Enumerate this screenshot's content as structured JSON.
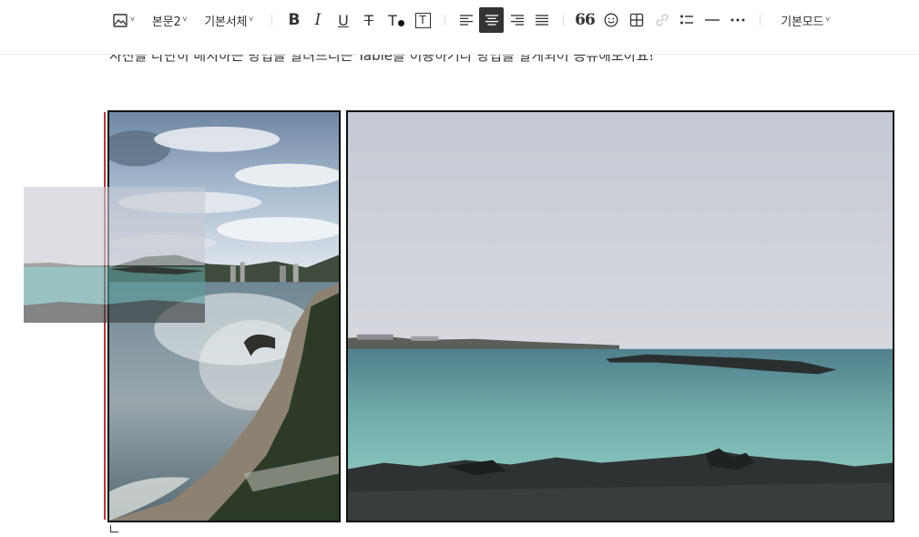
{
  "toolbar": {
    "items": [
      {
        "name": "image-insert",
        "icon": "image-icon",
        "has_caret": true
      },
      {
        "name": "paragraph-style",
        "label": "본문2",
        "has_caret": true
      },
      {
        "name": "font-family",
        "label": "기본서체",
        "has_caret": true
      },
      {
        "name": "bold",
        "label": "B"
      },
      {
        "name": "italic",
        "label": "I"
      },
      {
        "name": "underline",
        "label": "U"
      },
      {
        "name": "strikethrough",
        "label": "T"
      },
      {
        "name": "text-color",
        "label": "T"
      },
      {
        "name": "text-background",
        "label": "T"
      },
      {
        "name": "align-left",
        "icon": "align-left-icon"
      },
      {
        "name": "align-center",
        "icon": "align-center-icon",
        "active": true
      },
      {
        "name": "align-right",
        "icon": "align-right-icon"
      },
      {
        "name": "align-justify",
        "icon": "align-justify-icon"
      },
      {
        "name": "quote",
        "label": "66"
      },
      {
        "name": "emoticon",
        "icon": "smile-icon"
      },
      {
        "name": "table",
        "icon": "table-icon"
      },
      {
        "name": "link",
        "icon": "link-icon",
        "disabled": true
      },
      {
        "name": "bullet-list",
        "icon": "list-icon"
      },
      {
        "name": "horizontal-rule",
        "icon": "horizontal-rule-icon"
      },
      {
        "name": "more",
        "icon": "more-icon"
      },
      {
        "name": "editor-mode",
        "label": "기본모드",
        "has_caret": true
      }
    ],
    "caret_glyph": "v",
    "colors": {
      "active_bg": "#333333",
      "active_fg": "#ffffff",
      "disabled": "#c8c8c8"
    }
  },
  "content": {
    "paragraph": "사진을 나란히 배치하는 방법을 알려드리는 Table을 이용하거나 방법을 알게되어 공유해보아요!",
    "images": [
      {
        "name": "photo-left",
        "description": "coastal city beach with boardwalk"
      },
      {
        "name": "photo-right",
        "description": "turquoise sea with dark rocks"
      }
    ],
    "drag_ghost": {
      "name": "dragged-photo-preview"
    },
    "colors": {
      "cursor_line": "#b33a3a",
      "image_border": "#111111"
    }
  }
}
